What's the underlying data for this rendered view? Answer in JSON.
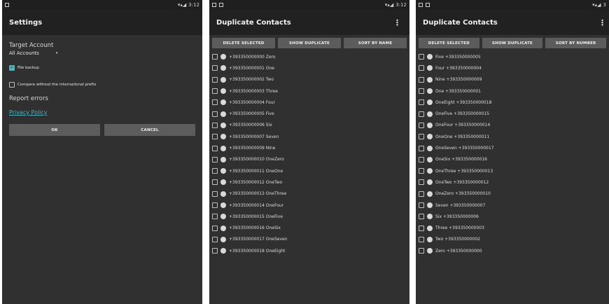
{
  "screens": {
    "settings": {
      "status_time": "3:12",
      "title": "Settings",
      "target_account_label": "Target Account",
      "target_account_value": "All Accounts",
      "file_backup_label": "File backup",
      "compare_label": "Compare without the international prefix",
      "report_errors_label": "Report errors",
      "privacy_policy_label": "Privacy Policy",
      "ok_label": "OK",
      "cancel_label": "CANCEL"
    },
    "dup_by_name": {
      "status_time": "3:12",
      "title": "Duplicate Contacts",
      "buttons": [
        "DELETE SELECTED",
        "SHOW DUPLICATE",
        "SORT BY NAME"
      ],
      "rows": [
        "+393350000000 Zero",
        "+393350000001 One",
        "+393350000002 Two",
        "+393350000003 Three",
        "+393350000004 Four",
        "+393350000005 Five",
        "+393350000006 Six",
        "+393350000007 Seven",
        "+393350000009 Nine",
        "+393350000010 OneZero",
        "+393350000011 OneOne",
        "+393350000012 OneTwo",
        "+393350000013 OneThree",
        "+393350000014 OneFour",
        "+393350000015 OneFive",
        "+393350000016 OneSix",
        "+393350000017 OneSeven",
        "+393350000018 OneEight"
      ]
    },
    "dup_by_number": {
      "status_time": "3",
      "title": "Duplicate Contacts",
      "buttons": [
        "DELETE SELECTED",
        "SHOW DUPLICATE",
        "SORT BY NUMBER"
      ],
      "rows": [
        "Five +393350000005",
        "Four +393350000004",
        "Nine +393350000009",
        "One +393350000001",
        "OneEight +393350000018",
        "OneFive +393350000015",
        "OneFour +393350000014",
        "OneOne +393350000011",
        "OneSeven +393350000017",
        "OneSix +393350000016",
        "OneThree +393350000013",
        "OneTwo +393350000012",
        "OneZero +393350000010",
        "Seven +393350000007",
        "Six +393350000006",
        "Three +393350000003",
        "Two +393350000002",
        "Zero +393350000000"
      ]
    }
  },
  "colors": {
    "accent": "#4fb3bf",
    "background": "#303030",
    "appbar": "#212121",
    "button": "#5c5c5c"
  }
}
